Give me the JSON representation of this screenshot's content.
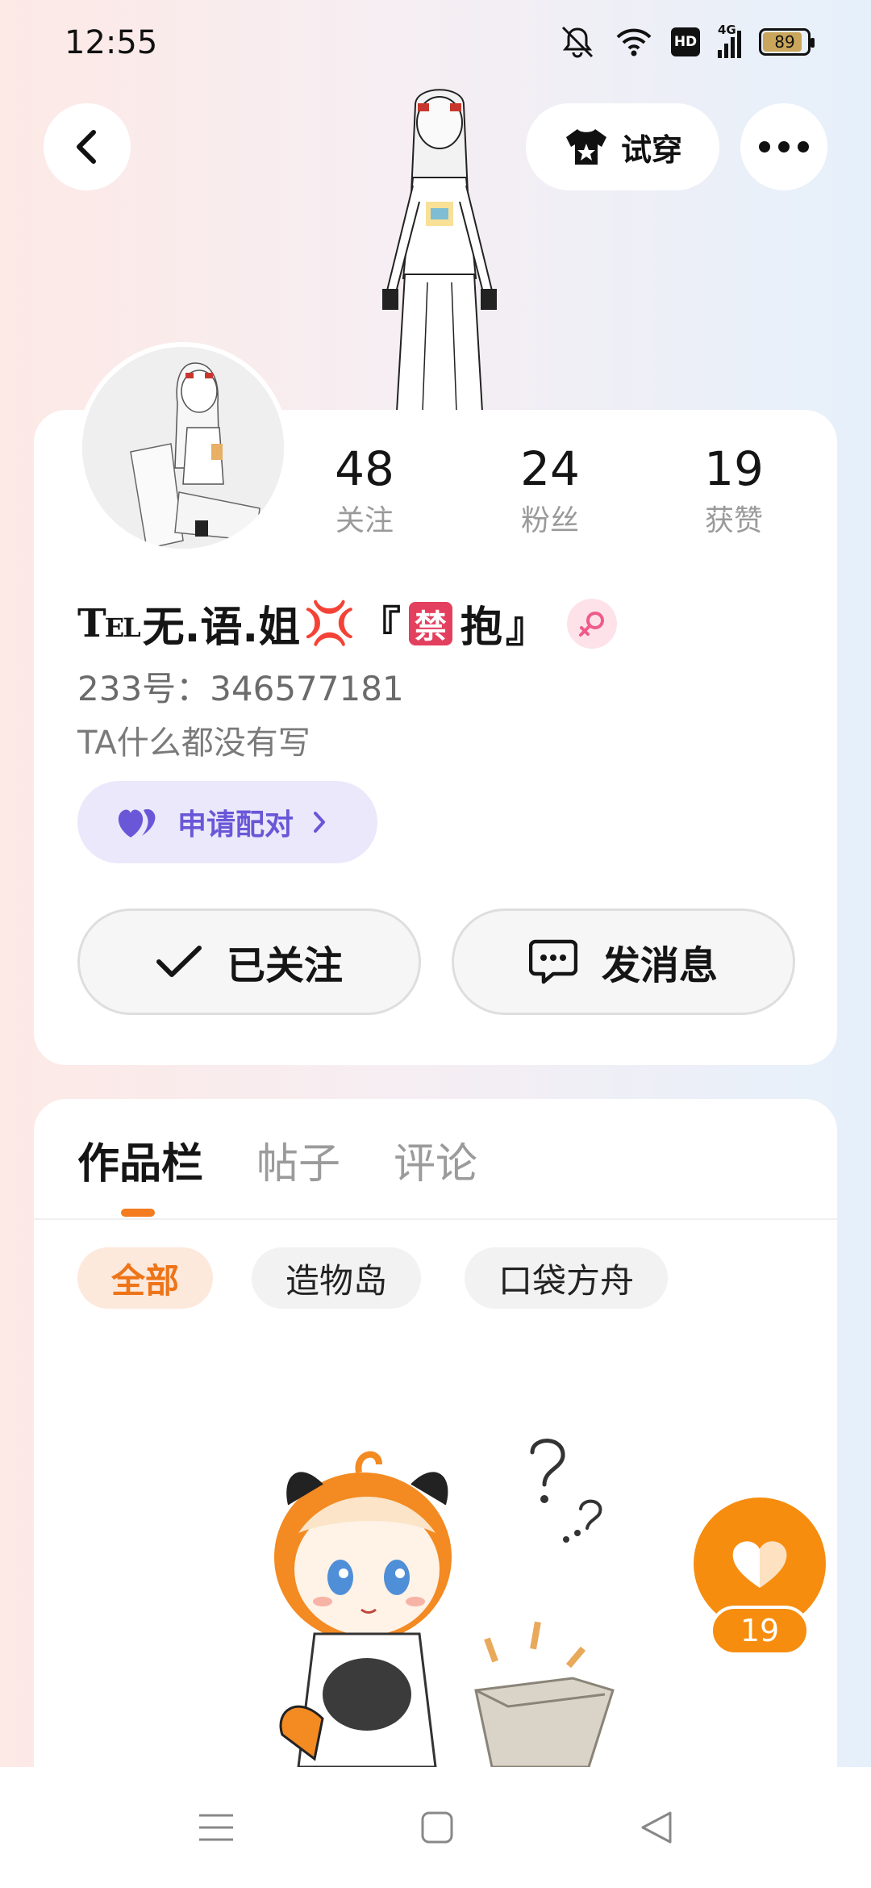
{
  "status_bar": {
    "time": "12:55",
    "hd": "HD",
    "network": "4G",
    "battery": "89",
    "battery_level": 0.89
  },
  "header": {
    "tryon_label": "试穿"
  },
  "profile": {
    "stats": [
      {
        "value": "48",
        "label": "关注"
      },
      {
        "value": "24",
        "label": "粉丝"
      },
      {
        "value": "19",
        "label": "获赞"
      }
    ],
    "nickname_prefix_big": "T",
    "nickname_prefix_small": "EL",
    "nickname_main": "无.语.姐",
    "nickname_emoji": "💢",
    "nickname_open": "『",
    "nickname_ban": "禁",
    "nickname_hug": "抱",
    "nickname_close": "』",
    "user_id": "233号：346577181",
    "bio": "TA什么都没有写",
    "pair_label": "申请配对",
    "follow_label": "已关注",
    "message_label": "发消息"
  },
  "works": {
    "tabs": [
      "作品栏",
      "帖子",
      "评论"
    ],
    "active_tab": 0,
    "filters": [
      "全部",
      "造物岛",
      "口袋方舟"
    ],
    "active_filter": 0,
    "like_count": "19"
  },
  "colors": {
    "accent": "#f68d0f",
    "pair": "#6957d8",
    "ban": "#e33f5e"
  }
}
